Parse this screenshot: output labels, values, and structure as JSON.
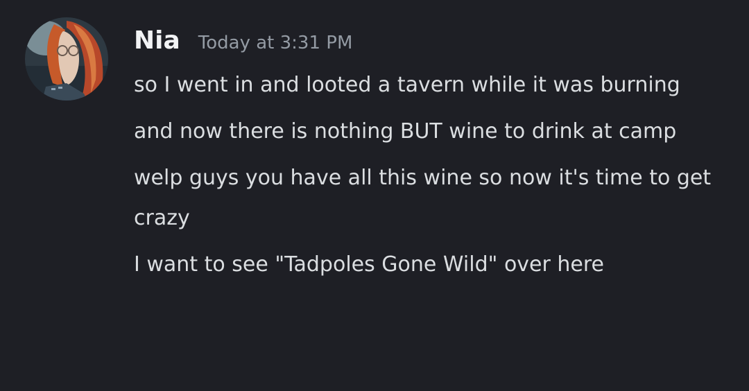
{
  "author": {
    "name": "Nia",
    "timestamp": "Today at 3:31 PM"
  },
  "messages": [
    {
      "text": "so I went in and looted a tavern while it was burning"
    },
    {
      "text": "and now there is nothing BUT wine to drink at camp"
    },
    {
      "text": "welp guys you have all this wine so now it's time to get crazy"
    },
    {
      "text": "I want to see \"Tadpoles Gone Wild\" over here"
    }
  ],
  "colors": {
    "background": "#1e1f25",
    "username": "#f2f3f5",
    "timestamp": "#949ba4",
    "message_text": "#dbdee1"
  }
}
